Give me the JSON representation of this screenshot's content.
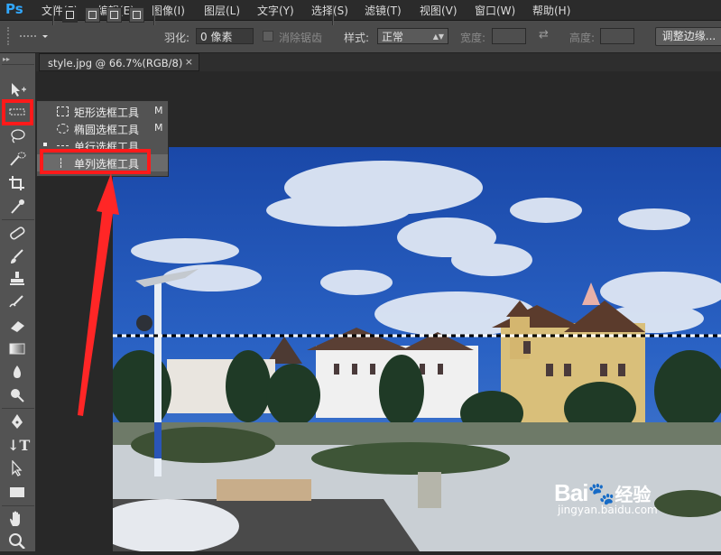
{
  "app": {
    "logo": "Ps"
  },
  "menu": [
    "文件(F)",
    "编辑(E)",
    "图像(I)",
    "图层(L)",
    "文字(Y)",
    "选择(S)",
    "滤镜(T)",
    "视图(V)",
    "窗口(W)",
    "帮助(H)"
  ],
  "options": {
    "feather_label": "羽化:",
    "feather_value": "0 像素",
    "antialias_label": "消除锯齿",
    "style_label": "样式:",
    "style_value": "正常",
    "width_label": "宽度:",
    "height_label": "高度:",
    "refine_edge_button": "调整边缘..."
  },
  "document_tab": {
    "title": "style.jpg @ 66.7%(RGB/8)",
    "close": "×"
  },
  "tool_popup": {
    "items": [
      {
        "label": "矩形选框工具",
        "shortcut": "M",
        "icon": "rect-marquee-icon"
      },
      {
        "label": "椭圆选框工具",
        "shortcut": "M",
        "icon": "ellipse-marquee-icon"
      },
      {
        "label": "单行选框工具",
        "shortcut": "",
        "icon": "single-row-marquee-icon"
      },
      {
        "label": "单列选框工具",
        "shortcut": "",
        "icon": "single-column-marquee-icon"
      }
    ],
    "selected_index": 3
  },
  "watermark": {
    "brand": "Bai",
    "brand2": "经验",
    "url": "jingyan.baidu.com"
  },
  "annotation_color": "#ff1a1a",
  "sky_color": "#1f54b8"
}
